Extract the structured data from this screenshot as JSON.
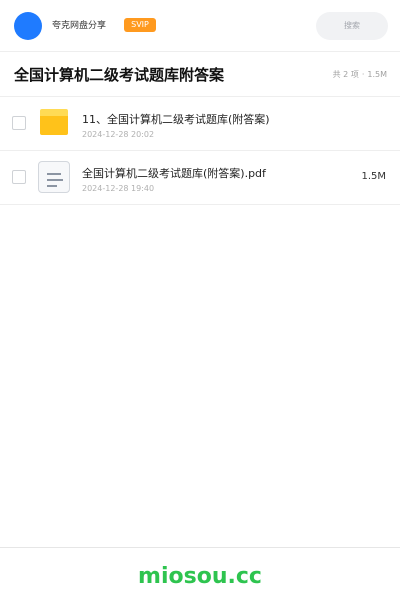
{
  "header": {
    "user_name": "夸克网盘分享",
    "vip_label": "SVIP",
    "search_label": "搜索"
  },
  "titlebar": {
    "title": "全国计算机二级考试题库附答案",
    "count": "共 2 项",
    "separator": "·",
    "total_size": "1.5M"
  },
  "files": [
    {
      "type": "folder",
      "name": "11、全国计算机二级考试题库(附答案)",
      "date": "2024-12-28 20:02",
      "size": ""
    },
    {
      "type": "document",
      "name": "全国计算机二级考试题库(附答案).pdf",
      "date": "2024-12-28 19:40",
      "size": "1.5M"
    }
  ],
  "footer": {
    "brand": "miosou.cc"
  },
  "colors": {
    "avatar": "#1f7bff",
    "vip": "#ff9a1f",
    "folder": "#ffc21a",
    "brand": "#2ec44f"
  }
}
